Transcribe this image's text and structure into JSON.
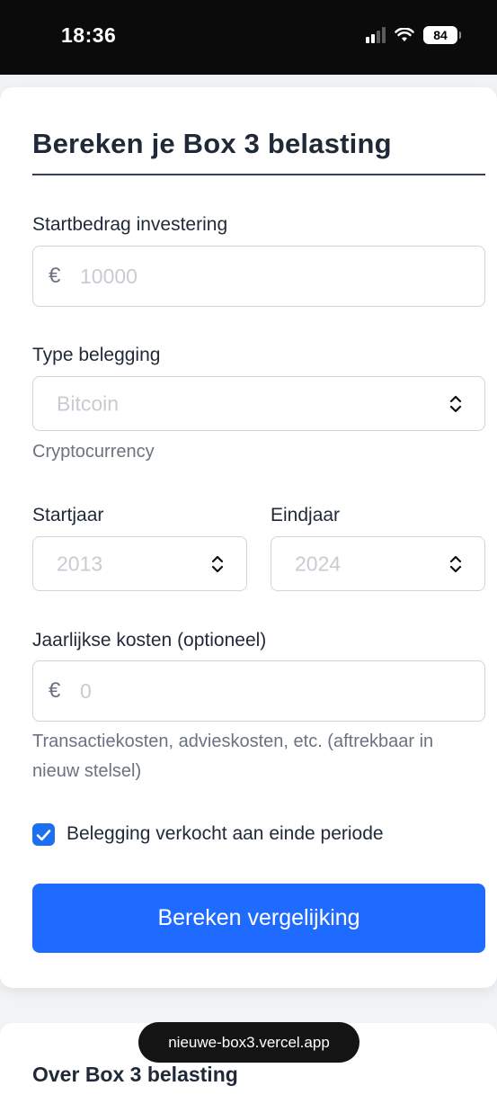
{
  "status_bar": {
    "time": "18:36",
    "battery": "84"
  },
  "form": {
    "title": "Bereken je Box 3 belasting",
    "start_amount": {
      "label": "Startbedrag investering",
      "prefix": "€",
      "placeholder": "10000"
    },
    "investment_type": {
      "label": "Type belegging",
      "value": "Bitcoin",
      "helper": "Cryptocurrency"
    },
    "start_year": {
      "label": "Startjaar",
      "value": "2013"
    },
    "end_year": {
      "label": "Eindjaar",
      "value": "2024"
    },
    "annual_costs": {
      "label": "Jaarlijkse kosten (optioneel)",
      "prefix": "€",
      "placeholder": "0",
      "helper_line1": "Transactiekosten, advieskosten, etc. (aftrekbaar in",
      "helper_line2": "nieuw stelsel)"
    },
    "sold_checkbox": {
      "label": "Belegging verkocht aan einde periode",
      "checked": true
    },
    "submit_label": "Bereken vergelijking"
  },
  "about": {
    "title": "Over Box 3 belasting"
  },
  "browser": {
    "url": "nieuwe-box3.vercel.app"
  },
  "colors": {
    "accent": "#1f6bff",
    "checkbox": "#1d6ff2"
  }
}
